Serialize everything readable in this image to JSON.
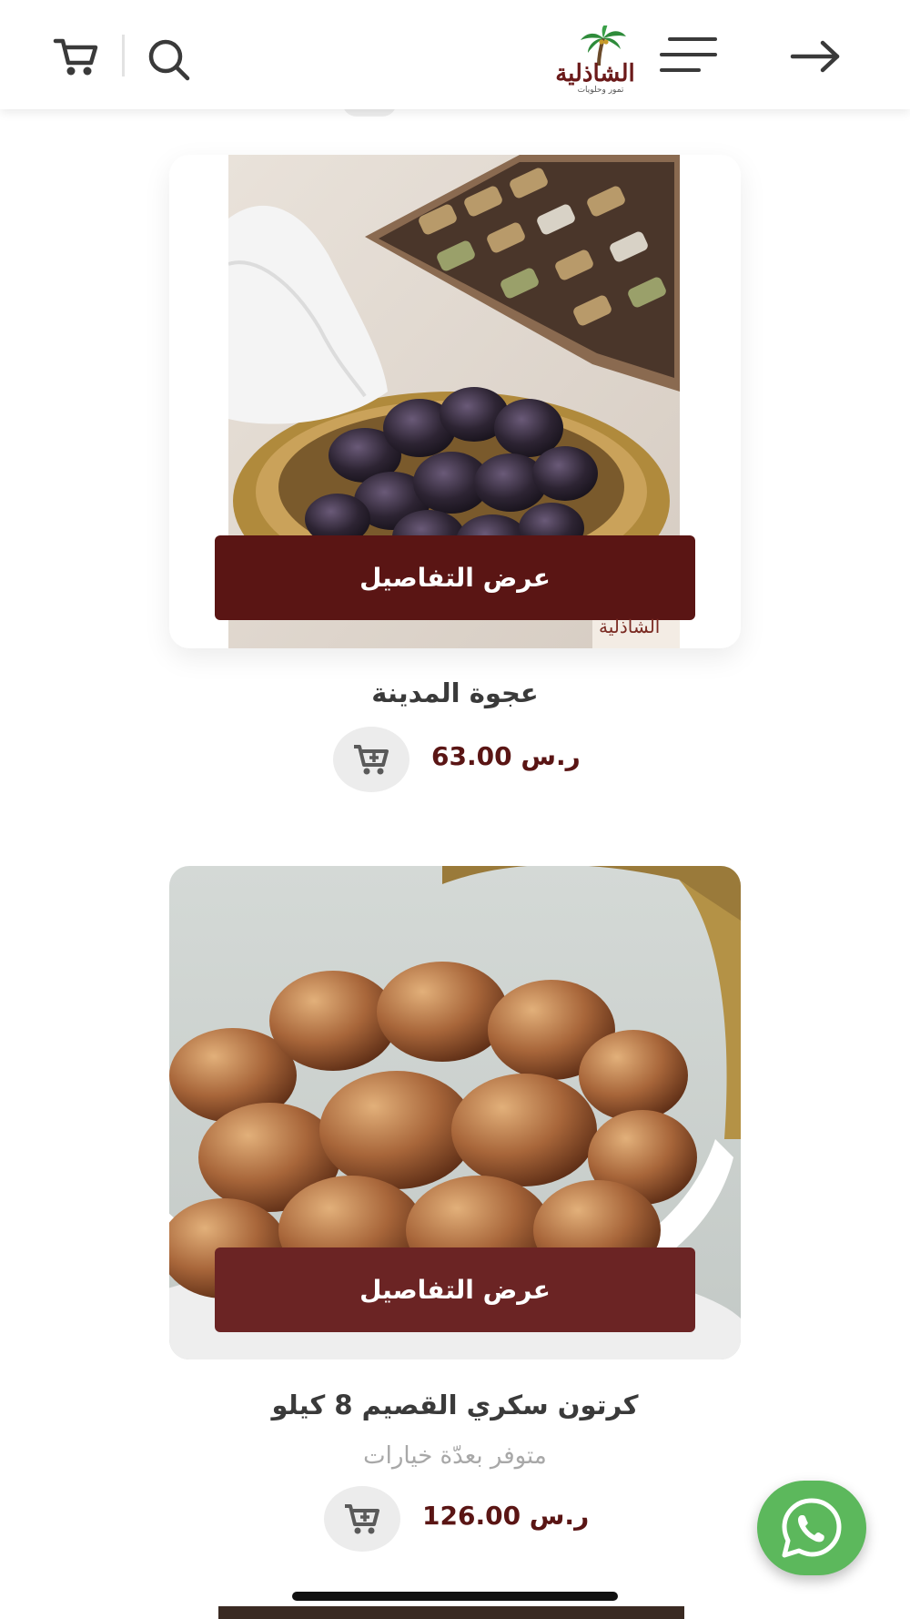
{
  "header": {
    "brand": "الشاذلية",
    "brand_sub": "تمور وحلويات"
  },
  "products": [
    {
      "title": "عجوة المدينة",
      "details_label": "عرض التفاصيل",
      "price": "63.00 ر.س",
      "watermark": "الشاذلية",
      "image": "ajwa-dates-photo"
    },
    {
      "title": "كرتون سكري القصيم 8 كيلو",
      "variant_note": "متوفر بعدّة خيارات",
      "details_label": "عرض التفاصيل",
      "price": "126.00 ر.س",
      "image": "sukkari-dates-photo"
    }
  ],
  "colors": {
    "accent": "#5a1514",
    "whatsapp": "#5cb85c",
    "icon": "#3a3a3a"
  },
  "icons": [
    "cart-icon",
    "search-icon",
    "menu-icon",
    "arrow-right-icon",
    "add-to-cart-icon",
    "whatsapp-icon"
  ]
}
